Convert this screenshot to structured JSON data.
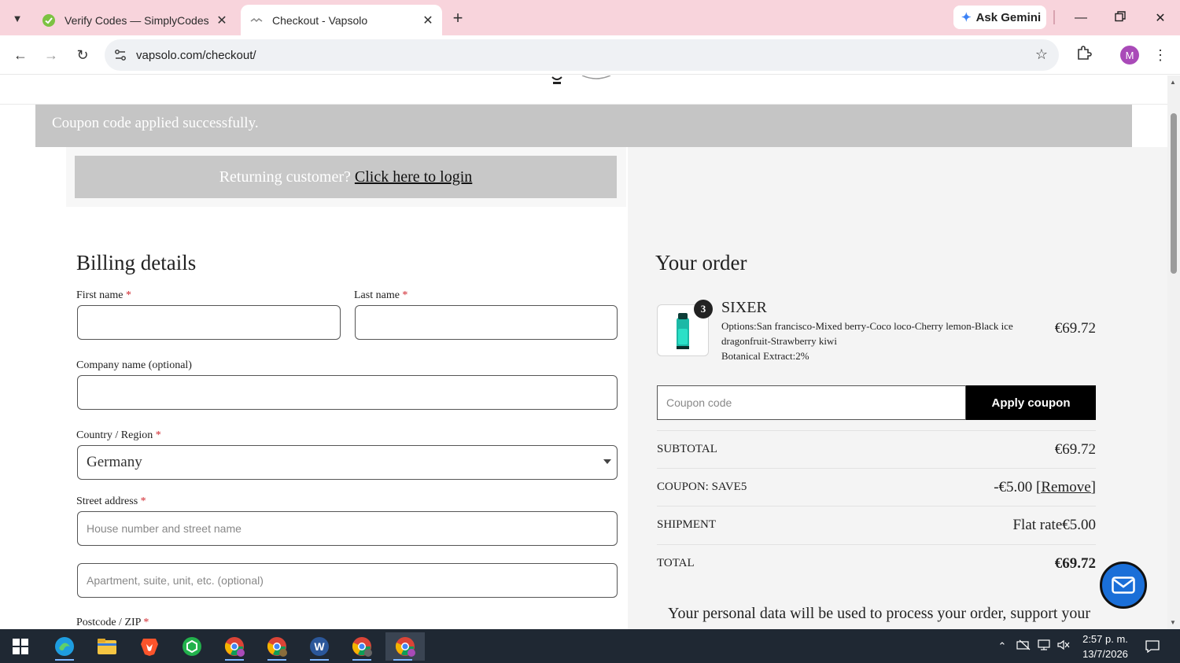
{
  "browser": {
    "tabs": [
      {
        "title": "Verify Codes — SimplyCodes",
        "active": false
      },
      {
        "title": "Checkout - Vapsolo",
        "active": true
      }
    ],
    "gemini_label": "Ask Gemini",
    "url": "vapsolo.com/checkout/",
    "profile_initial": "M"
  },
  "page": {
    "notice": "Coupon code applied successfully.",
    "returning_text": "Returning customer?",
    "returning_link": "Click here to login",
    "billing": {
      "heading": "Billing details",
      "first_name_label": "First name",
      "last_name_label": "Last name",
      "company_label": "Company name (optional)",
      "country_label": "Country / Region",
      "country_value": "Germany",
      "street_label": "Street address",
      "street_placeholder": "House number and street name",
      "apartment_placeholder": "Apartment, suite, unit, etc. (optional)",
      "postcode_label": "Postcode / ZIP",
      "required_mark": "*"
    },
    "order": {
      "heading": "Your order",
      "product": {
        "quantity": "3",
        "name": "SIXER",
        "options_line1": "Options:San francisco-Mixed berry-Coco loco-Cherry lemon-Black ice dragonfruit-Strawberry kiwi",
        "options_line2": "Botanical Extract:2%",
        "price": "€69.72"
      },
      "coupon_placeholder": "Coupon code",
      "apply_coupon": "Apply coupon",
      "rows": [
        {
          "label": "SUBTOTAL",
          "value": "€69.72"
        },
        {
          "label": "COUPON: SAVE5",
          "value": "-€5.00",
          "link": "[Remove]"
        },
        {
          "label": "SHIPMENT",
          "value": "Flat rate€5.00"
        },
        {
          "label": "TOTAL",
          "value": "€69.72"
        }
      ],
      "privacy_text": "Your personal data will be used to process your order, support your"
    }
  },
  "taskbar": {
    "time": "2:57 p. m.",
    "date": "13/7/2026"
  },
  "colors": {
    "tabbar": "#f8d4dc",
    "notice_bg": "#c5c5c5",
    "required": "#d0242b",
    "fab": "#1a6fd8"
  }
}
